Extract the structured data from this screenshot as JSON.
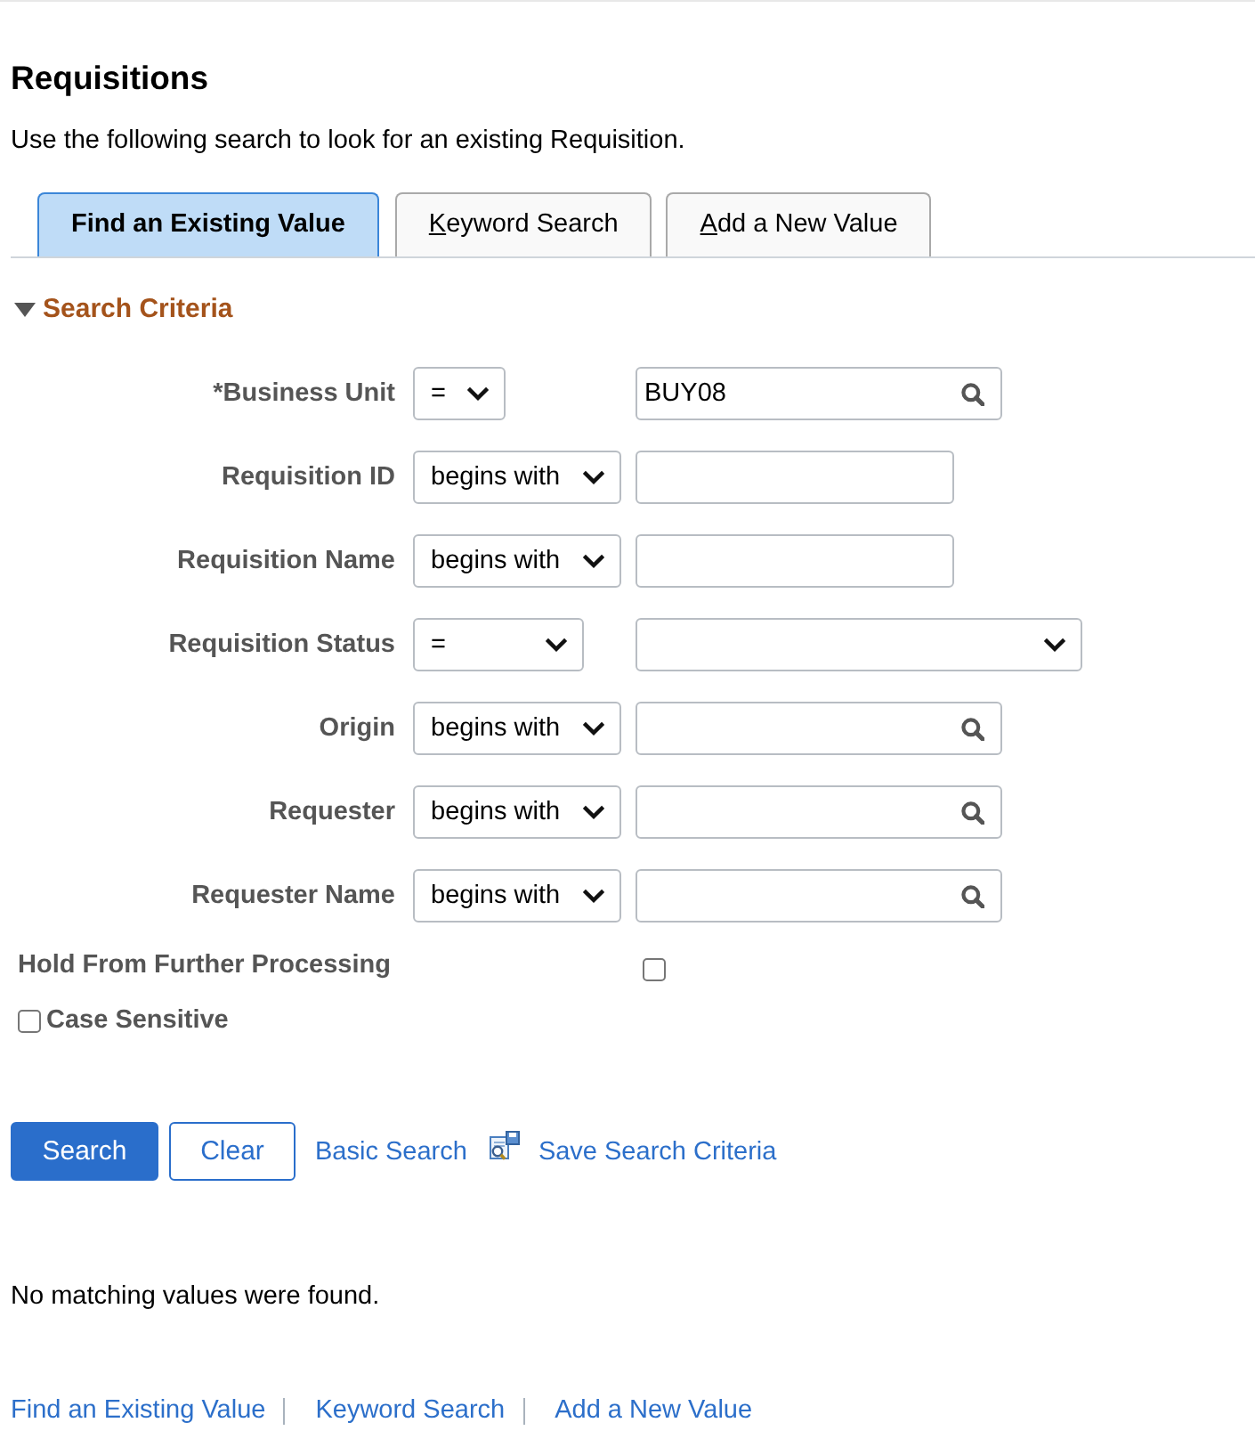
{
  "page": {
    "title": "Requisitions",
    "instructions": "Use the following search to look for an existing Requisition."
  },
  "tabs": [
    {
      "label": "Find an Existing Value",
      "selected": true,
      "access_key_underlined": false
    },
    {
      "label": "Keyword Search",
      "selected": false,
      "access_key_underlined": true
    },
    {
      "label": "Add a New Value",
      "selected": false,
      "access_key_underlined": true
    }
  ],
  "search_criteria": {
    "heading": "Search Criteria",
    "expanded": true,
    "fields": [
      {
        "label": "*Business Unit",
        "operator": "=",
        "kind": "lookup",
        "value": "BUY08"
      },
      {
        "label": "Requisition ID",
        "operator": "begins with",
        "kind": "text"
      },
      {
        "label": "Requisition Name",
        "operator": "begins with",
        "kind": "text"
      },
      {
        "label": "Requisition Status",
        "operator": "=",
        "kind": "dropdown"
      },
      {
        "label": "Origin",
        "operator": "begins with",
        "kind": "lookup"
      },
      {
        "label": "Requester",
        "operator": "begins with",
        "kind": "lookup"
      },
      {
        "label": "Requester Name",
        "operator": "begins with",
        "kind": "lookup"
      }
    ],
    "options": [
      {
        "label": "Hold From Further Processing",
        "kind": "field_checkbox",
        "checked": false
      },
      {
        "label": "Case Sensitive",
        "kind": "inline_checkbox",
        "checked": false
      }
    ]
  },
  "actions": [
    {
      "label": "Search",
      "kind": "primary"
    },
    {
      "label": "Clear",
      "kind": "secondary"
    },
    {
      "label": "Basic Search",
      "kind": "link"
    },
    {
      "label": "Save Search Criteria",
      "kind": "icon_link"
    }
  ],
  "message": "No matching values were found.",
  "footer_links": [
    {
      "label": "Find an Existing Value"
    },
    {
      "label": "Keyword Search"
    },
    {
      "label": "Add a New Value"
    }
  ]
}
